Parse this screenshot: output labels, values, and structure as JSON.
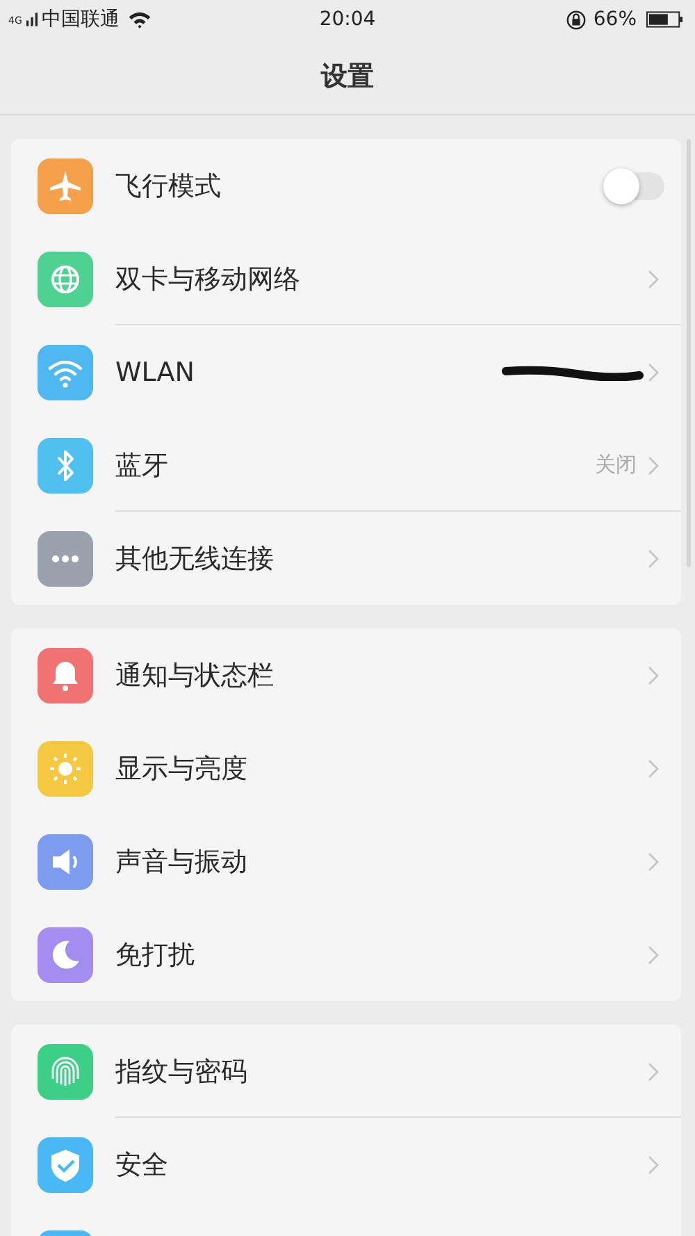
{
  "status_bar": {
    "network": "4G",
    "carrier": "中国联通",
    "time": "20:04",
    "battery": "66%"
  },
  "title": "设置",
  "groups": [
    {
      "rows": [
        {
          "kind": "toggle",
          "label": "飞行模式",
          "color": "#f5a04a",
          "on": false,
          "divider": false
        },
        {
          "kind": "link",
          "label": "双卡与移动网络",
          "color": "#4fd194",
          "divider": true
        },
        {
          "kind": "redacted",
          "label": "WLAN",
          "color": "#4fb8f0",
          "divider": false
        },
        {
          "kind": "link",
          "label": "蓝牙",
          "color": "#4fc0ef",
          "value": "关闭",
          "divider": true
        },
        {
          "kind": "link",
          "label": "其他无线连接",
          "color": "#9aa1ad",
          "divider": false
        }
      ]
    },
    {
      "rows": [
        {
          "kind": "link",
          "label": "通知与状态栏",
          "color": "#f07272",
          "divider": false
        },
        {
          "kind": "link",
          "label": "显示与亮度",
          "color": "#f5c842",
          "divider": false
        },
        {
          "kind": "link",
          "label": "声音与振动",
          "color": "#7d9bef",
          "divider": false
        },
        {
          "kind": "link",
          "label": "免打扰",
          "color": "#a58cf0",
          "divider": false
        }
      ]
    },
    {
      "rows": [
        {
          "kind": "link",
          "label": "指纹与密码",
          "color": "#3dcf88",
          "divider": true
        },
        {
          "kind": "link",
          "label": "安全",
          "color": "#4ab8f5",
          "divider": false
        },
        {
          "kind": "partial",
          "color": "#4ab8f5",
          "divider": false
        }
      ]
    }
  ]
}
